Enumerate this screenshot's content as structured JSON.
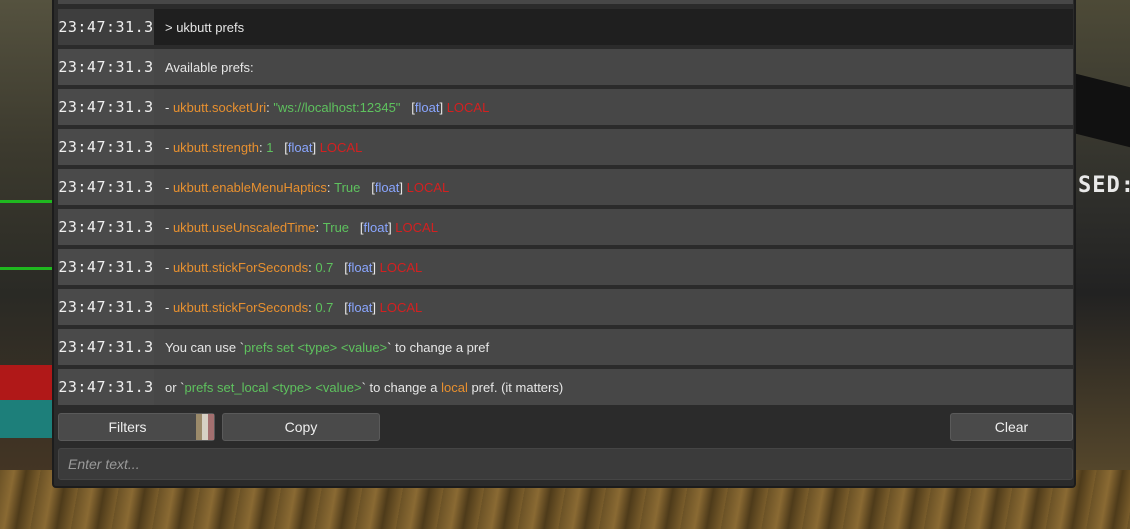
{
  "console": {
    "rows": [
      {
        "time": "23:47:31.3",
        "kind": "command",
        "parts": [
          {
            "t": "> ukbutt prefs",
            "c": "w"
          }
        ]
      },
      {
        "time": "23:47:31.3",
        "kind": "info",
        "parts": [
          {
            "t": "Available prefs:",
            "c": "w"
          }
        ]
      },
      {
        "time": "23:47:31.3",
        "kind": "info",
        "parts": [
          {
            "t": "- ",
            "c": "w"
          },
          {
            "t": "ukbutt.socketUri",
            "c": "o"
          },
          {
            "t": ": ",
            "c": "w"
          },
          {
            "t": "\"ws://localhost:12345\"",
            "c": "g"
          },
          {
            "t": "   [",
            "c": "w"
          },
          {
            "t": "float",
            "c": "b"
          },
          {
            "t": "] ",
            "c": "w"
          },
          {
            "t": "LOCAL",
            "c": "r"
          }
        ]
      },
      {
        "time": "23:47:31.3",
        "kind": "info",
        "parts": [
          {
            "t": "- ",
            "c": "w"
          },
          {
            "t": "ukbutt.strength",
            "c": "o"
          },
          {
            "t": ": ",
            "c": "w"
          },
          {
            "t": "1",
            "c": "g"
          },
          {
            "t": "   [",
            "c": "w"
          },
          {
            "t": "float",
            "c": "b"
          },
          {
            "t": "] ",
            "c": "w"
          },
          {
            "t": "LOCAL",
            "c": "r"
          }
        ]
      },
      {
        "time": "23:47:31.3",
        "kind": "info",
        "parts": [
          {
            "t": "- ",
            "c": "w"
          },
          {
            "t": "ukbutt.enableMenuHaptics",
            "c": "o"
          },
          {
            "t": ": ",
            "c": "w"
          },
          {
            "t": "True",
            "c": "g"
          },
          {
            "t": "   [",
            "c": "w"
          },
          {
            "t": "float",
            "c": "b"
          },
          {
            "t": "] ",
            "c": "w"
          },
          {
            "t": "LOCAL",
            "c": "r"
          }
        ]
      },
      {
        "time": "23:47:31.3",
        "kind": "info",
        "parts": [
          {
            "t": "- ",
            "c": "w"
          },
          {
            "t": "ukbutt.useUnscaledTime",
            "c": "o"
          },
          {
            "t": ": ",
            "c": "w"
          },
          {
            "t": "True",
            "c": "g"
          },
          {
            "t": "   [",
            "c": "w"
          },
          {
            "t": "float",
            "c": "b"
          },
          {
            "t": "] ",
            "c": "w"
          },
          {
            "t": "LOCAL",
            "c": "r"
          }
        ]
      },
      {
        "time": "23:47:31.3",
        "kind": "info",
        "parts": [
          {
            "t": "- ",
            "c": "w"
          },
          {
            "t": "ukbutt.stickForSeconds",
            "c": "o"
          },
          {
            "t": ": ",
            "c": "w"
          },
          {
            "t": "0.7",
            "c": "g"
          },
          {
            "t": "   [",
            "c": "w"
          },
          {
            "t": "float",
            "c": "b"
          },
          {
            "t": "] ",
            "c": "w"
          },
          {
            "t": "LOCAL",
            "c": "r"
          }
        ]
      },
      {
        "time": "23:47:31.3",
        "kind": "info",
        "parts": [
          {
            "t": "- ",
            "c": "w"
          },
          {
            "t": "ukbutt.stickForSeconds",
            "c": "o"
          },
          {
            "t": ": ",
            "c": "w"
          },
          {
            "t": "0.7",
            "c": "g"
          },
          {
            "t": "   [",
            "c": "w"
          },
          {
            "t": "float",
            "c": "b"
          },
          {
            "t": "] ",
            "c": "w"
          },
          {
            "t": "LOCAL",
            "c": "r"
          }
        ]
      },
      {
        "time": "23:47:31.3",
        "kind": "info",
        "parts": [
          {
            "t": "You can use ",
            "c": "w"
          },
          {
            "t": "`",
            "c": "w"
          },
          {
            "t": "prefs set <type> <value>",
            "c": "g"
          },
          {
            "t": "`",
            "c": "w"
          },
          {
            "t": " to change a pref",
            "c": "w"
          }
        ]
      },
      {
        "time": "23:47:31.3",
        "kind": "info",
        "parts": [
          {
            "t": "or ",
            "c": "w"
          },
          {
            "t": "`",
            "c": "w"
          },
          {
            "t": "prefs set_local <type> <value>",
            "c": "g"
          },
          {
            "t": "`",
            "c": "w"
          },
          {
            "t": " to change a ",
            "c": "w"
          },
          {
            "t": "local",
            "c": "o"
          },
          {
            "t": " pref. (it matters)",
            "c": "w"
          }
        ]
      }
    ]
  },
  "toolbar": {
    "filters_label": "Filters",
    "copy_label": "Copy",
    "clear_label": "Clear",
    "filter_swatch_colors": [
      "#9b8a6a",
      "#d6d0c4",
      "#a36f6f"
    ]
  },
  "input": {
    "placeholder": "Enter text..."
  },
  "background": {
    "overlay_text": "SED:"
  },
  "colors": {
    "pref_name": "#e8902f",
    "value": "#5ec25e",
    "type": "#8aa6ff",
    "scope": "#d42020",
    "text": "#e6e6e6"
  }
}
